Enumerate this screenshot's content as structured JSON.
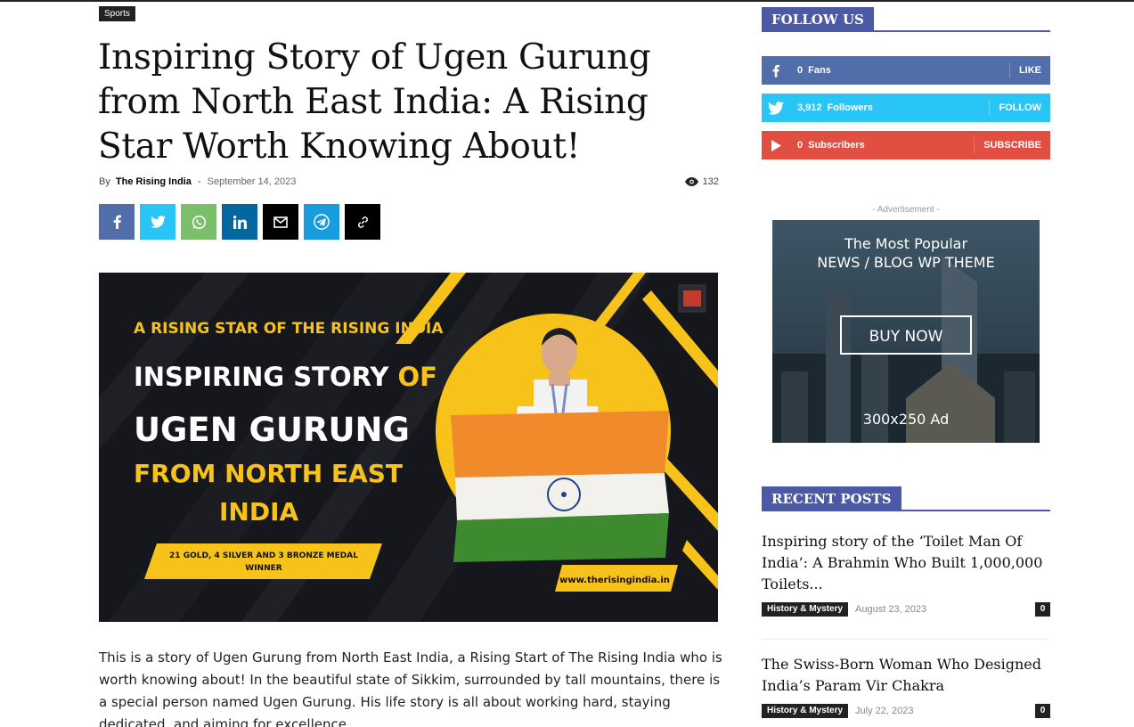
{
  "article": {
    "category": "Sports",
    "title": "Inspiring Story of Ugen Gurung from North East India: A Rising Star Worth Knowing About!",
    "by_label": "By",
    "author": "The Rising India",
    "separator": "-",
    "date": "September 14, 2023",
    "views": "132",
    "body": "This is a story of Ugen Gurung from North East India, a Rising Start of The Rising India who is worth knowing about! In the beautiful state of Sikkim, surrounded by tall mountains, there is a special person named Ugen Gurung. His life story is all about working hard, staying dedicated, and aiming for excellence."
  },
  "share_buttons": [
    {
      "name": "facebook",
      "icon": "facebook-icon",
      "color": "#516eab"
    },
    {
      "name": "twitter",
      "icon": "twitter-icon",
      "color": "#29c5f6"
    },
    {
      "name": "whatsapp",
      "icon": "whatsapp-icon",
      "color": "#7bbf6a"
    },
    {
      "name": "linkedin",
      "icon": "linkedin-icon",
      "color": "#0266a0"
    },
    {
      "name": "email",
      "icon": "email-icon",
      "color": "#000000"
    },
    {
      "name": "telegram",
      "icon": "telegram-icon",
      "color": "#179cde"
    },
    {
      "name": "copy-link",
      "icon": "link-icon",
      "color": "#000000"
    }
  ],
  "hero_image": {
    "kicker": "A RISING STAR OF THE RISING INDIA",
    "line1_white": "INSPIRING STORY ",
    "line1_yellow": "OF",
    "line2": "UGEN GURUNG",
    "line3": "FROM NORTH EAST",
    "line4": "INDIA",
    "medal_line1": "21 GOLD, 4 SILVER AND 3 BRONZE MEDAL",
    "medal_line2": "WINNER",
    "website": "www.therisingindia.in"
  },
  "sidebar": {
    "follow_title": "FOLLOW US",
    "social": [
      {
        "icon": "facebook-icon",
        "count": "0",
        "label": "Fans",
        "action": "LIKE",
        "color": "#516eab"
      },
      {
        "icon": "twitter-icon",
        "count": "3,912",
        "label": "Followers",
        "action": "FOLLOW",
        "color": "#29c5f6"
      },
      {
        "icon": "youtube-icon",
        "count": "0",
        "label": "Subscribers",
        "action": "SUBSCRIBE",
        "color": "#e14e42"
      }
    ],
    "ad_label": "- Advertisement -",
    "ad": {
      "line1": "The Most Popular",
      "line2": "NEWS / BLOG WP THEME",
      "button": "BUY NOW",
      "size": "300x250 Ad"
    },
    "recent_title": "RECENT POSTS",
    "recent_posts": [
      {
        "title": "Inspiring story of the ‘Toilet Man Of India’: A Brahmin Who Built 1,000,000 Toilets...",
        "category": "History & Mystery",
        "date": "August 23, 2023",
        "comments": "0"
      },
      {
        "title": "The Swiss-Born Woman Who Designed India’s Param Vir Chakra",
        "category": "History & Mystery",
        "date": "July 22, 2023",
        "comments": "0"
      }
    ]
  },
  "colors": {
    "accent": "#4b5aa6",
    "hero_yellow": "#f7c31a",
    "dark": "#222222"
  }
}
